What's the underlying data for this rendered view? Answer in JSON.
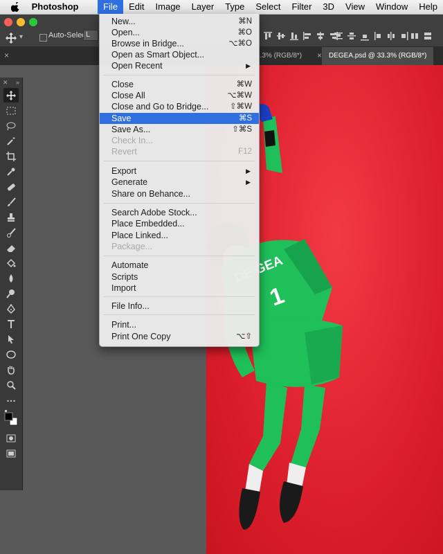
{
  "menubar": {
    "app_name": "Photoshop CC",
    "menus": [
      "File",
      "Edit",
      "Image",
      "Layer",
      "Type",
      "Select",
      "Filter",
      "3D",
      "View",
      "Window",
      "Help"
    ],
    "active_menu": "File"
  },
  "options": {
    "auto_select_label": "Auto-Select:",
    "auto_select_value": "L"
  },
  "tabs": [
    {
      "label": "×"
    },
    {
      "label": "3.3% (RGB/8*)"
    },
    {
      "label": "DEGEA.psd @ 33.3% (RGB/8*)"
    }
  ],
  "file_menu": {
    "items": [
      {
        "label": "New...",
        "shortcut": "⌘N"
      },
      {
        "label": "Open...",
        "shortcut": "⌘O"
      },
      {
        "label": "Browse in Bridge...",
        "shortcut": "⌥⌘O"
      },
      {
        "label": "Open as Smart Object...",
        "shortcut": ""
      },
      {
        "label": "Open Recent",
        "shortcut": "▶"
      },
      {
        "label": "Close",
        "shortcut": "⌘W"
      },
      {
        "label": "Close All",
        "shortcut": "⌥⌘W"
      },
      {
        "label": "Close and Go to Bridge...",
        "shortcut": "⇧⌘W"
      },
      {
        "label": "Save",
        "shortcut": "⌘S"
      },
      {
        "label": "Save As...",
        "shortcut": "⇧⌘S"
      },
      {
        "label": "Check In...",
        "shortcut": ""
      },
      {
        "label": "Revert",
        "shortcut": "F12"
      },
      {
        "label": "Export",
        "shortcut": "▶"
      },
      {
        "label": "Generate",
        "shortcut": "▶"
      },
      {
        "label": "Share on Behance...",
        "shortcut": ""
      },
      {
        "label": "Search Adobe Stock...",
        "shortcut": ""
      },
      {
        "label": "Place Embedded...",
        "shortcut": ""
      },
      {
        "label": "Place Linked...",
        "shortcut": ""
      },
      {
        "label": "Package...",
        "shortcut": ""
      },
      {
        "label": "Automate",
        "shortcut": ""
      },
      {
        "label": "Scripts",
        "shortcut": ""
      },
      {
        "label": "Import",
        "shortcut": ""
      },
      {
        "label": "File Info...",
        "shortcut": ""
      },
      {
        "label": "Print...",
        "shortcut": ""
      },
      {
        "label": "Print One Copy",
        "shortcut": "⌥⇧"
      }
    ]
  },
  "canvas": {
    "jersey_name": "DE GEA",
    "jersey_number": "1",
    "bg_color": "#e0222f",
    "kit_color": "#1fbf5a"
  },
  "icons": [
    "apple-icon",
    "move-tool-icon",
    "marquee-tool-icon",
    "lasso-tool-icon",
    "magic-wand-icon",
    "crop-tool-icon",
    "eyedropper-icon",
    "healing-brush-icon",
    "brush-tool-icon",
    "clone-stamp-icon",
    "history-brush-icon",
    "eraser-icon",
    "paint-bucket-icon",
    "blur-tool-icon",
    "dodge-tool-icon",
    "pen-tool-icon",
    "type-tool-icon",
    "path-selection-icon",
    "ellipse-tool-icon",
    "hand-tool-icon",
    "zoom-tool-icon",
    "more-tools-icon",
    "color-swatches-icon",
    "quick-mask-icon",
    "screen-mode-icon"
  ]
}
